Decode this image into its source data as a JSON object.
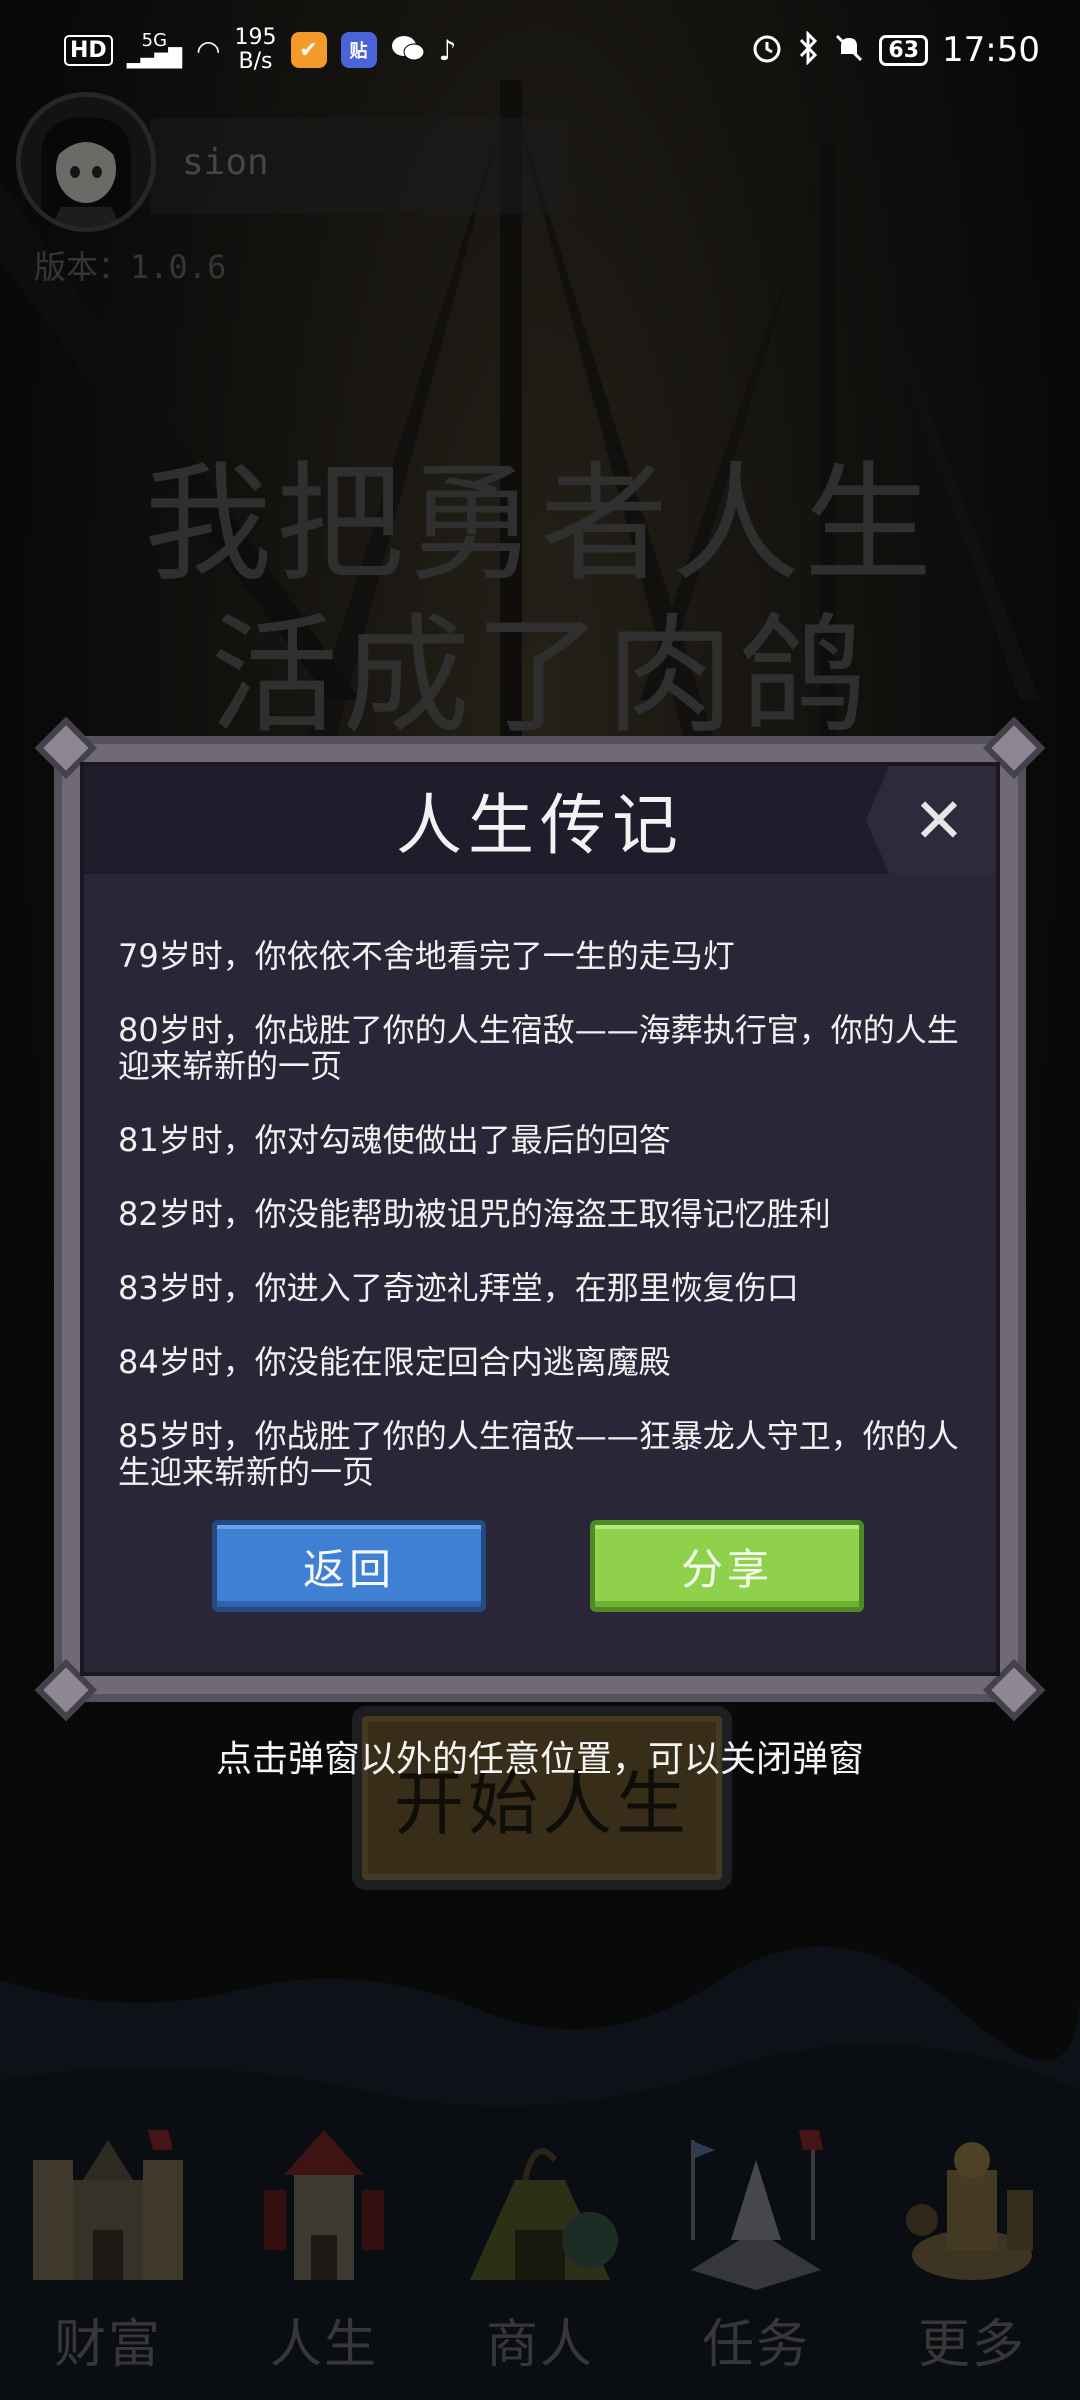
{
  "status_bar": {
    "hd": "HD",
    "network": "5G",
    "speed_value": "195",
    "speed_unit": "B/s",
    "time": "17:50",
    "battery": "63",
    "apps": [
      {
        "icon": "task-app-icon",
        "glyph": "✔",
        "color": "#f39a2b"
      },
      {
        "icon": "tieba-app-icon",
        "glyph": "贴",
        "color": "#4b63d8"
      },
      {
        "icon": "wechat-app-icon",
        "glyph": "",
        "color": "#ffffff"
      },
      {
        "icon": "tiktok-app-icon",
        "glyph": "♪",
        "color": "#ffffff"
      }
    ],
    "indicators": [
      "alarm-icon",
      "bluetooth-icon",
      "mute-icon"
    ]
  },
  "user": {
    "name": "sion",
    "version": "版本：1.0.6"
  },
  "game_title": {
    "line1": "我把勇者人生",
    "line2": "活成了肉鸽"
  },
  "start_button": {
    "label": "开始人生"
  },
  "modal": {
    "title": "人生传记",
    "entries": [
      "79岁时，你依依不舍地看完了一生的走马灯",
      "80岁时，你战胜了你的人生宿敌——海葬执行官，你的人生迎来崭新的一页",
      "81岁时，你对勾魂使做出了最后的回答",
      "82岁时，你没能帮助被诅咒的海盗王取得记忆胜利",
      "83岁时，你进入了奇迹礼拜堂，在那里恢复伤口",
      "84岁时，你没能在限定回合内逃离魔殿",
      "85岁时，你战胜了你的人生宿敌——狂暴龙人守卫，你的人生迎来崭新的一页"
    ],
    "back_label": "返回",
    "share_label": "分享",
    "hint": "点击弹窗以外的任意位置，可以关闭弹窗"
  },
  "bottom_nav": [
    {
      "label": "财富",
      "icon": "castle-icon"
    },
    {
      "label": "人生",
      "icon": "tower-icon"
    },
    {
      "label": "商人",
      "icon": "tent-icon"
    },
    {
      "label": "任务",
      "icon": "altar-icon"
    },
    {
      "label": "更多",
      "icon": "workshop-icon"
    }
  ],
  "colors": {
    "modal_bg": "#2a2637",
    "back_button": "#3f7fd4",
    "share_button": "#8fd14a"
  }
}
